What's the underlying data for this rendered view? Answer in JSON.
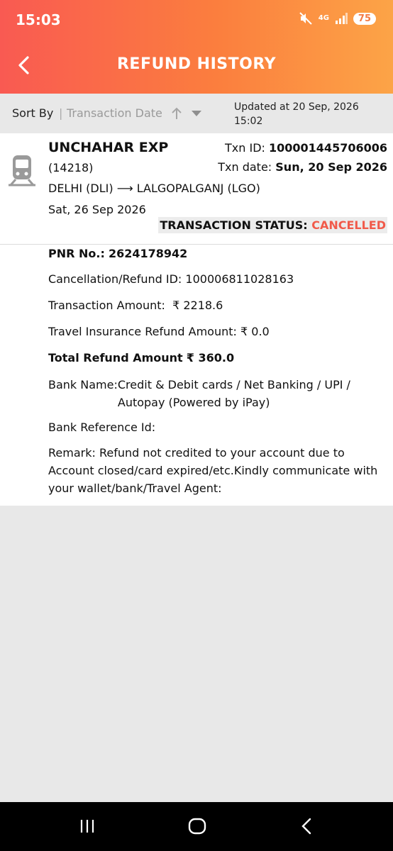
{
  "status_bar": {
    "time": "15:03",
    "network": "4G",
    "battery": "75",
    "icons": [
      "mute-icon",
      "signal-icon",
      "battery-icon"
    ]
  },
  "header": {
    "title": "REFUND HISTORY",
    "back_icon": "chevron-left-icon",
    "gradient": [
      "#f95a52",
      "#fca447"
    ]
  },
  "sort": {
    "label": "Sort By",
    "separator": "|",
    "value": "Transaction Date",
    "updated": "Updated at 20 Sep, 2026 15:02"
  },
  "transaction": {
    "train_name": "UNCHAHAR EXP",
    "train_number": "(14218)",
    "route": "DELHI (DLI) ⟶ LALGOPALGANJ (LGO)",
    "journey_date": "Sat, 26 Sep 2026",
    "txn_id_label": "Txn ID:",
    "txn_id": "100001445706006",
    "txn_date_label": "Txn date:",
    "txn_date": "Sun, 20 Sep 2026",
    "status_label": "TRANSACTION STATUS:",
    "status_value": "CANCELLED",
    "status_color": "#f15a4a"
  },
  "details": {
    "pnr_label": "PNR No.:",
    "pnr": "2624178942",
    "cancellation_label": "Cancellation/Refund ID:",
    "cancellation_id": "100006811028163",
    "txn_amount_label": "Transaction Amount:",
    "txn_amount": "₹ 2218.6",
    "insurance_label": "Travel Insurance Refund Amount:",
    "insurance_amount": "₹ 0.0",
    "total_label": "Total Refund Amount",
    "total_amount": "₹ 360.0",
    "bank_label": "Bank Name:",
    "bank_value": "Credit & Debit cards / Net Banking / UPI / Autopay (Powered by iPay)",
    "bank_ref_label": "Bank Reference Id:",
    "remark": "Remark: Refund not credited to your account due to Account closed/card expired/etc.Kindly communicate with your wallet/bank/Travel Agent:"
  },
  "nav": {
    "icons": [
      "recents-icon",
      "home-icon",
      "back-icon"
    ]
  }
}
